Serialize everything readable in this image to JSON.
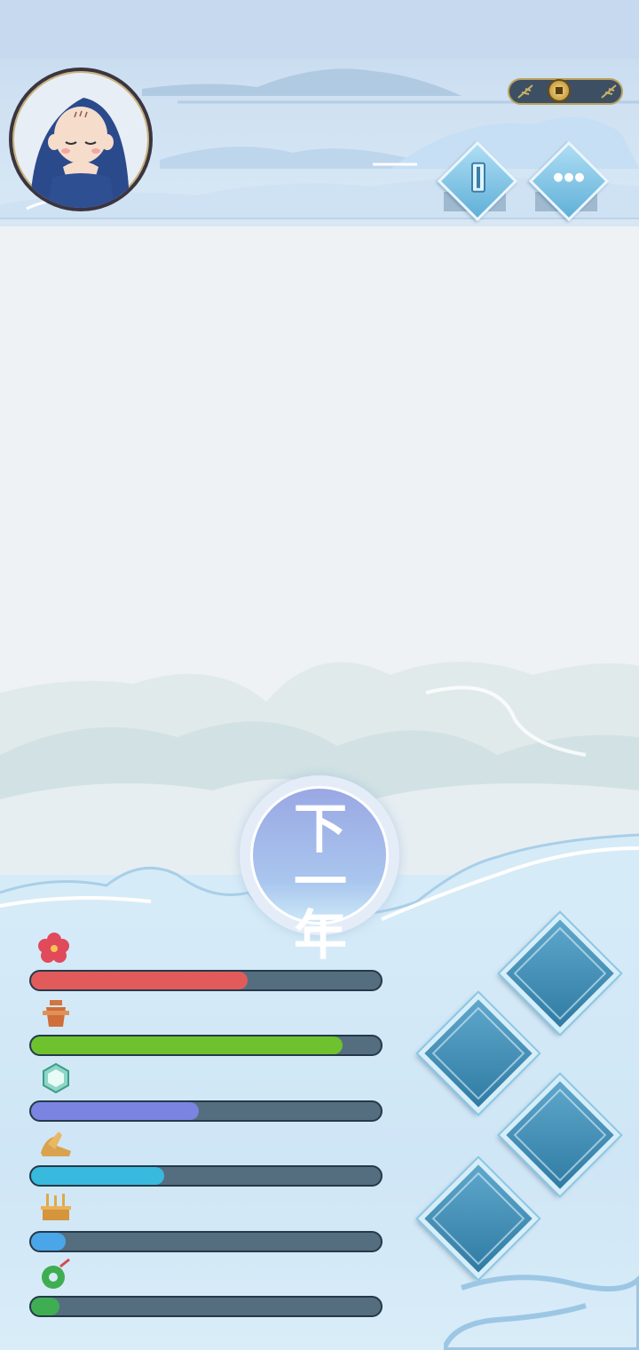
{
  "header": {
    "avatar_icon": "monk-avatar",
    "currency_icon": "copper-coin-icon",
    "buttons": [
      {
        "name": "bookmark-button",
        "icon": "scroll-icon"
      },
      {
        "name": "more-button",
        "icon": "more-dots-icon"
      }
    ]
  },
  "main": {
    "next_year_label": "下一年"
  },
  "stats": [
    {
      "icon": "flower-icon",
      "fill": 0.62,
      "color": "#e25b5b"
    },
    {
      "icon": "bell-icon",
      "fill": 0.89,
      "color": "#6ec22e"
    },
    {
      "icon": "mirror-icon",
      "fill": 0.48,
      "color": "#7b84e0"
    },
    {
      "icon": "shoes-icon",
      "fill": 0.38,
      "color": "#38b9de"
    },
    {
      "icon": "incense-burner-icon",
      "fill": 0.1,
      "color": "#4aa6e8"
    },
    {
      "icon": "jade-pendant-icon",
      "fill": 0.08,
      "color": "#3fae52"
    }
  ],
  "action_tiles": [
    {
      "name": "action-tile-1"
    },
    {
      "name": "action-tile-2"
    },
    {
      "name": "action-tile-3"
    },
    {
      "name": "action-tile-4"
    }
  ]
}
